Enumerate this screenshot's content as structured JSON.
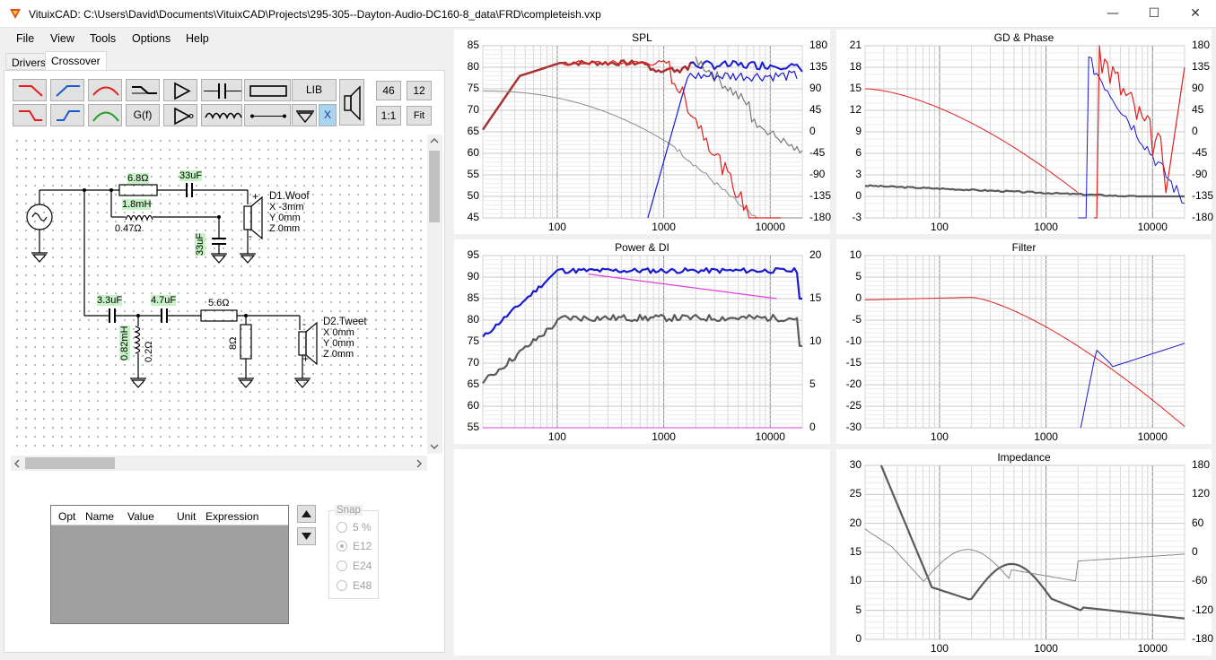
{
  "window": {
    "title": "VituixCAD: C:\\Users\\David\\Documents\\VituixCAD\\Projects\\295-305--Dayton-Audio-DC160-8_data\\FRD\\completeish.vxp",
    "minimize": "—",
    "maximize": "☐",
    "close": "✕"
  },
  "menu": [
    "File",
    "View",
    "Tools",
    "Options",
    "Help"
  ],
  "tabs": [
    {
      "label": "Drivers",
      "active": false
    },
    {
      "label": "Crossover",
      "active": true
    }
  ],
  "toolbar": {
    "lib": "LIB",
    "gf": "G(f)",
    "x": "X",
    "num1": "46",
    "num2": "12",
    "ratio": "1:1",
    "fit": "Fit",
    "icons": [
      "lowpass-red-icon",
      "highpass-blue-icon",
      "bandpass-red-icon",
      "shelf-icon",
      "buffer-amp-icon",
      "capacitor-icon",
      "resistor-icon",
      "lowpass2-red-icon",
      "highpass2-blue-icon",
      "bandpass-green-icon",
      "inverting-amp-icon",
      "inductor-icon",
      "wire-icon",
      "ground-icon",
      "speaker-icon"
    ]
  },
  "schematic": {
    "r1": "6.8Ω",
    "c1": "33uF",
    "l1": "1.8mH",
    "l1r": "0.47Ω",
    "c2": "33uF",
    "d1": [
      "D1.Woof",
      "X -3mm",
      "Y 0mm",
      "Z 0mm"
    ],
    "c3": "3.3uF",
    "c4": "4.7uF",
    "r2": "5.6Ω",
    "l2": "0.82mH",
    "l2r": "0.2Ω",
    "r3": "8Ω",
    "d2": [
      "D2.Tweet",
      "X 0mm",
      "Y 0mm",
      "Z 0mm"
    ],
    "plus": "+",
    "minus": "-"
  },
  "opt_table": {
    "headers": [
      "Opt",
      "Name",
      "Value",
      "Unit",
      "Expression"
    ]
  },
  "snap": {
    "title": "Snap",
    "options": [
      "5 %",
      "E12",
      "E24",
      "E48"
    ],
    "selected": "E12"
  },
  "colors": {
    "red": "#e02020",
    "darkred": "#a83232",
    "blue": "#1a1ad0",
    "gray": "#6a6a6a",
    "magenta": "#e040e0"
  },
  "charts": {
    "spl": {
      "title": "SPL",
      "ylabels": [
        "85",
        "80",
        "75",
        "70",
        "65",
        "60",
        "55",
        "50",
        "45"
      ],
      "y2labels": [
        "180",
        "135",
        "90",
        "45",
        "0",
        "-45",
        "-90",
        "-135",
        "-180"
      ],
      "xlabels": [
        "100",
        "1000",
        "10000"
      ]
    },
    "gd": {
      "title": "GD & Phase",
      "ylabels": [
        "21",
        "18",
        "15",
        "12",
        "9",
        "6",
        "3",
        "0",
        "-3"
      ],
      "y2labels": [
        "180",
        "135",
        "90",
        "45",
        "0",
        "-45",
        "-90",
        "-135",
        "-180"
      ],
      "xlabels": [
        "100",
        "1000",
        "10000"
      ]
    },
    "power": {
      "title": "Power & DI",
      "ylabels": [
        "95",
        "90",
        "85",
        "80",
        "75",
        "70",
        "65",
        "60",
        "55"
      ],
      "y2labels": [
        "20",
        "15",
        "10",
        "5",
        "0"
      ],
      "xlabels": [
        "100",
        "1000",
        "10000"
      ]
    },
    "filter": {
      "title": "Filter",
      "ylabels": [
        "10",
        "5",
        "0",
        "-5",
        "-10",
        "-15",
        "-20",
        "-25",
        "-30"
      ],
      "xlabels": [
        "100",
        "1000",
        "10000"
      ]
    },
    "imp": {
      "title": "Impedance",
      "ylabels": [
        "30",
        "25",
        "20",
        "15",
        "10",
        "5",
        "0"
      ],
      "y2labels": [
        "180",
        "120",
        "60",
        "0",
        "-60",
        "-120",
        "-180"
      ],
      "xlabels": [
        "100",
        "1000",
        "10000"
      ]
    }
  }
}
